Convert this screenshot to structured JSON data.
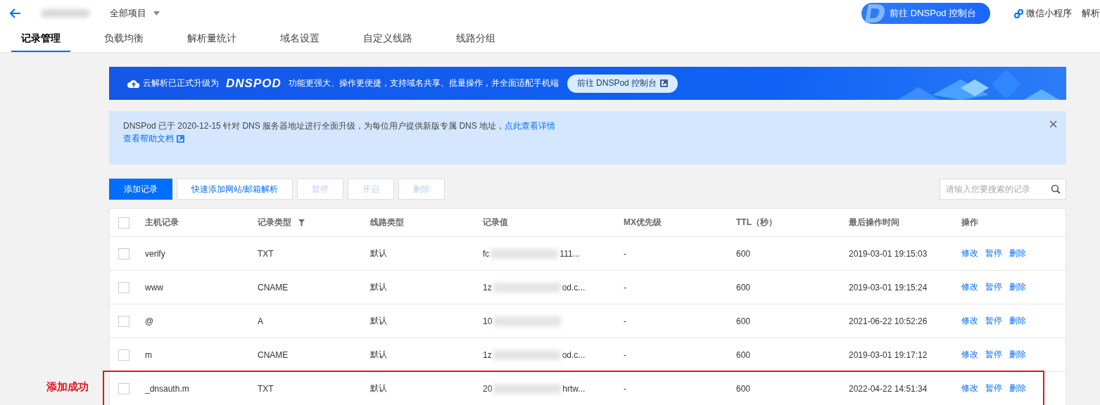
{
  "header": {
    "project_selector": "全部项目",
    "console_button": "前往 DNSPod 控制台",
    "mini_program_link": "微信小程序",
    "cut_link": "解析"
  },
  "tabs": [
    {
      "label": "记录管理",
      "selected": true
    },
    {
      "label": "负载均衡",
      "selected": false
    },
    {
      "label": "解析量统计",
      "selected": false
    },
    {
      "label": "域名设置",
      "selected": false
    },
    {
      "label": "自定义线路",
      "selected": false
    },
    {
      "label": "线路分组",
      "selected": false
    }
  ],
  "banner": {
    "text_before": "云解析已正式升级为",
    "logo": "DNSPOD",
    "text_after": "功能更强大、操作更便捷，支持域名共享、批量操作，并全面适配手机端",
    "button": "前往 DNSPod 控制台"
  },
  "notice": {
    "text": "DNSPod 已于 2020-12-15 针对 DNS 服务器地址进行全面升级，为每位用户提供新版专属 DNS 地址，",
    "link": "点此查看详情",
    "help_link": "查看帮助文档",
    "close": "×"
  },
  "toolbar": {
    "buttons": [
      {
        "label": "添加记录",
        "kind": "primary",
        "disabled": false
      },
      {
        "label": "快速添加网站/邮箱解析",
        "kind": "outline",
        "disabled": false
      },
      {
        "label": "暂停",
        "kind": "outline",
        "disabled": true
      },
      {
        "label": "开启",
        "kind": "outline",
        "disabled": true
      },
      {
        "label": "删除",
        "kind": "outline",
        "disabled": true
      }
    ],
    "search": {
      "placeholder": "请输入您要搜索的记录"
    }
  },
  "table": {
    "all_checked": false,
    "columns": [
      "主机记录",
      "记录类型",
      "线路类型",
      "记录值",
      "MX优先级",
      "TTL（秒）",
      "最后操作时间",
      "操作"
    ],
    "rows": [
      {
        "checked": false,
        "highlighted": false,
        "host": "verify",
        "type": "TXT",
        "line": "默认",
        "value_start": "fc",
        "value_end": "111...",
        "mx": "-",
        "ttl": "600",
        "time": "2019-03-01 19:15:03",
        "actions": [
          "修改",
          "暂停",
          "删除"
        ]
      },
      {
        "checked": false,
        "highlighted": false,
        "host": "www",
        "type": "CNAME",
        "line": "默认",
        "value_start": "1z",
        "value_end": "od.c...",
        "mx": "-",
        "ttl": "600",
        "time": "2019-03-01 19:15:24",
        "actions": [
          "修改",
          "暂停",
          "删除"
        ]
      },
      {
        "checked": false,
        "highlighted": false,
        "host": "@",
        "type": "A",
        "line": "默认",
        "value_start": "10",
        "value_end": "",
        "mx": "-",
        "ttl": "600",
        "time": "2021-06-22 10:52:26",
        "actions": [
          "修改",
          "暂停",
          "删除"
        ]
      },
      {
        "checked": false,
        "highlighted": false,
        "host": "m",
        "type": "CNAME",
        "line": "默认",
        "value_start": "1z",
        "value_end": "od.c...",
        "mx": "-",
        "ttl": "600",
        "time": "2019-03-01 19:17:12",
        "actions": [
          "修改",
          "暂停",
          "删除"
        ]
      },
      {
        "checked": false,
        "highlighted": true,
        "host": "_dnsauth.m",
        "type": "TXT",
        "line": "默认",
        "value_start": "20",
        "value_end": "hrtw...",
        "mx": "-",
        "ttl": "600",
        "time": "2022-04-22 14:51:34",
        "actions": [
          "修改",
          "暂停",
          "删除"
        ]
      }
    ]
  },
  "annotation": "添加成功"
}
